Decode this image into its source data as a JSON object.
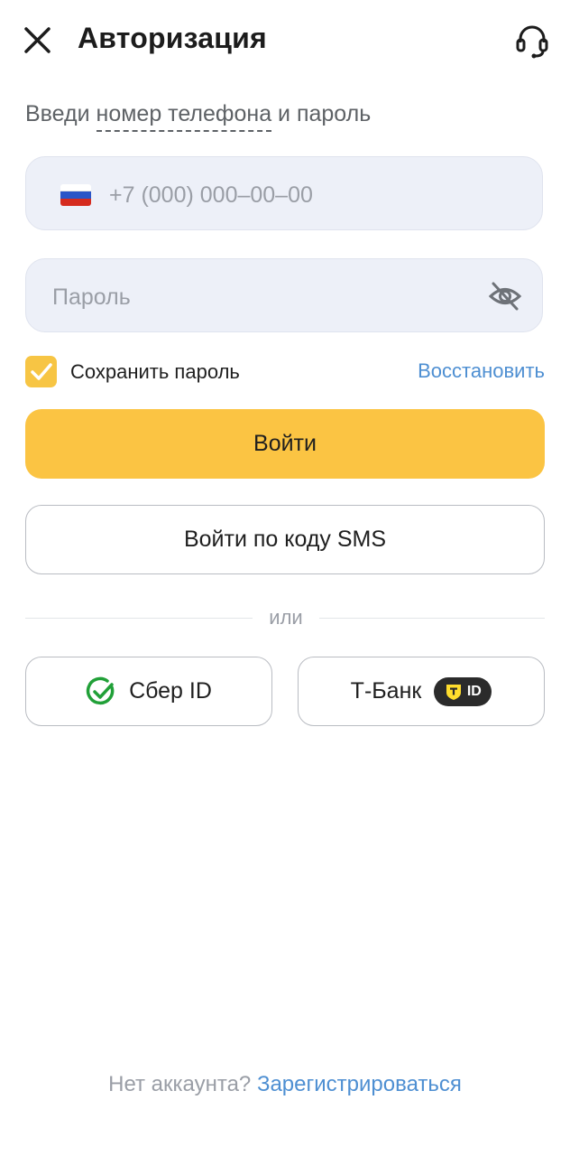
{
  "header": {
    "title": "Авторизация",
    "close_icon": "close-icon",
    "support_icon": "headset-icon"
  },
  "subtitle": {
    "prefix": "Введи ",
    "underlined": "номер телефона",
    "suffix": " и пароль"
  },
  "phone": {
    "placeholder": "+7 (000) 000–00–00",
    "flag_icon": "russia-flag-icon"
  },
  "password": {
    "placeholder": "Пароль",
    "toggle_icon": "eye-crossed-icon"
  },
  "remember": {
    "label": "Сохранить пароль",
    "checked": true
  },
  "restore_label": "Восстановить",
  "buttons": {
    "login": "Войти",
    "sms_login": "Войти по коду SMS"
  },
  "divider_text": "или",
  "sber": {
    "label": "Сбер ID"
  },
  "tbank": {
    "label": "Т-Банк",
    "badge": "ID"
  },
  "footer": {
    "question": "Нет аккаунта? ",
    "register": "Зарегистрироваться"
  },
  "colors": {
    "accent": "#fbc443",
    "link": "#4e8fd2",
    "field_bg": "#edf0f8",
    "sber_green": "#21a038"
  }
}
